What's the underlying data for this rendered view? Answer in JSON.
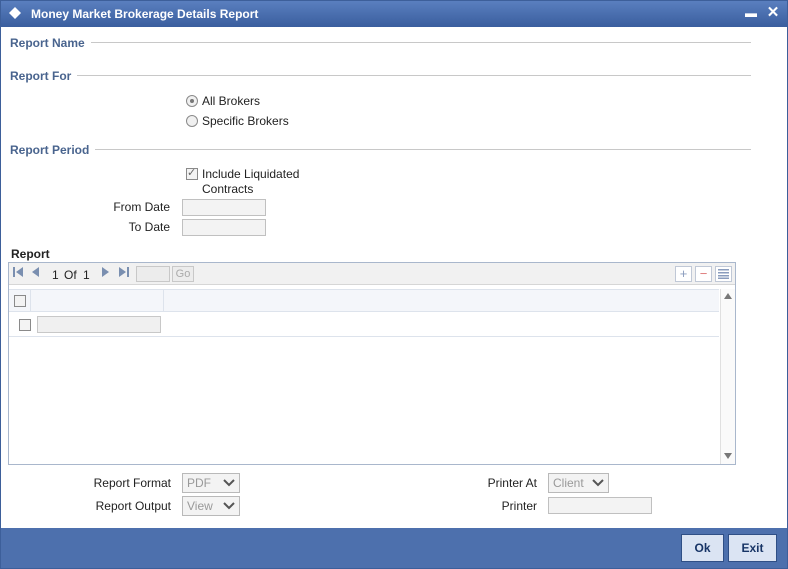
{
  "window": {
    "title": "Money Market Brokerage Details Report",
    "minimize_label": "▬",
    "close_label": "✕"
  },
  "sections": {
    "report_name": "Report Name",
    "report_for": "Report For",
    "report_period": "Report Period"
  },
  "report_for": {
    "options": [
      {
        "label": "All Brokers",
        "checked": true
      },
      {
        "label": "Specific Brokers",
        "checked": false
      }
    ]
  },
  "report_period": {
    "include_liquidated_line1": "Include Liquidated",
    "include_liquidated_line2": "Contracts",
    "include_liquidated_checked": true,
    "from_date_label": "From Date",
    "from_date_value": "",
    "to_date_label": "To Date",
    "to_date_value": ""
  },
  "report_grid": {
    "title": "Report",
    "current_page": "1",
    "of_label": "Of",
    "total_pages": "1",
    "go_label": "Go",
    "add_label": "+",
    "remove_label": "−",
    "rows": [
      {
        "value": ""
      }
    ]
  },
  "output": {
    "report_format_label": "Report Format",
    "report_format_value": "PDF",
    "report_output_label": "Report Output",
    "report_output_value": "View",
    "printer_at_label": "Printer At",
    "printer_at_value": "Client",
    "printer_label": "Printer",
    "printer_value": ""
  },
  "footer": {
    "ok_label": "Ok",
    "exit_label": "Exit"
  },
  "colors": {
    "titlebar": "#3a5e9e",
    "section_label": "#49648e",
    "footer": "#4d70ad"
  }
}
